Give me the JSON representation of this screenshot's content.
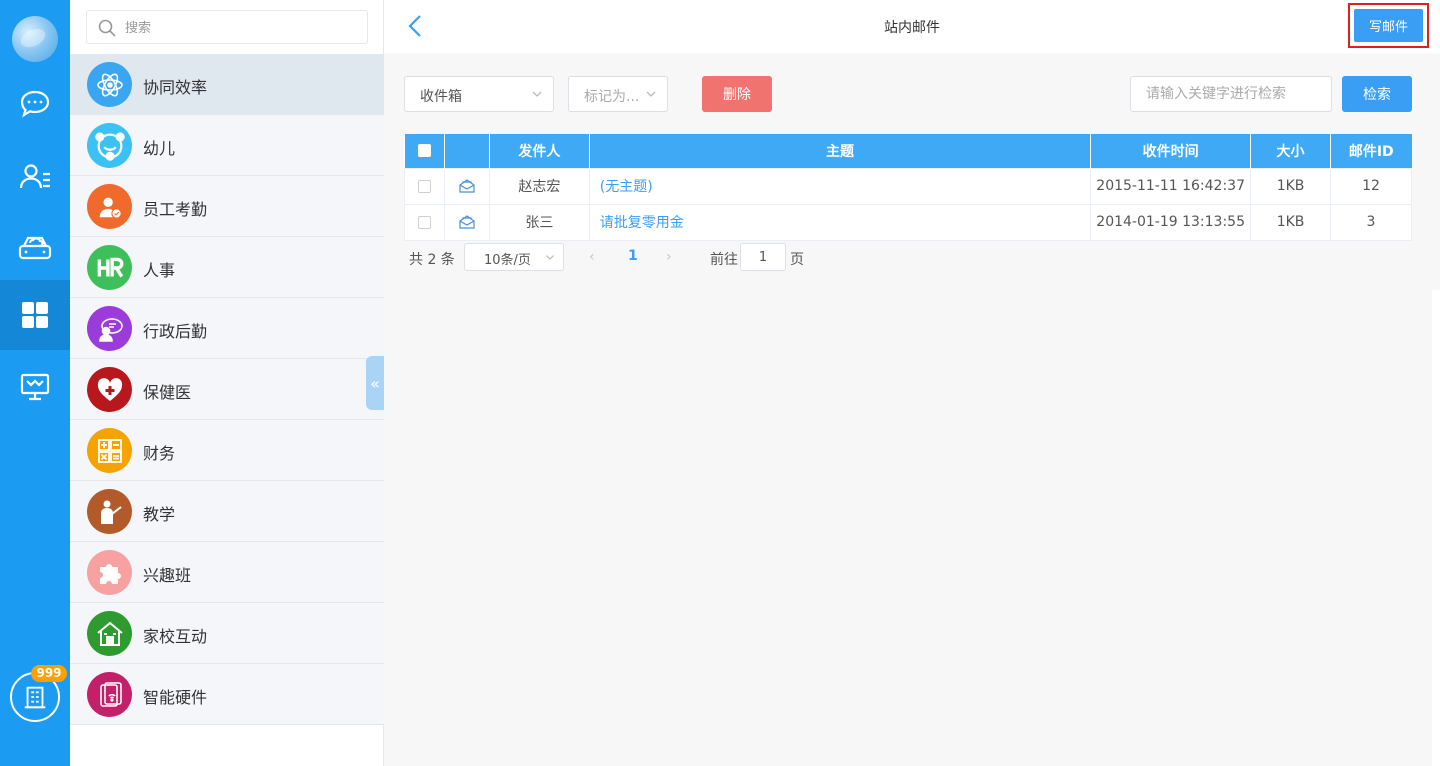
{
  "rail": {
    "items": [
      {
        "icon": "chat-icon"
      },
      {
        "icon": "contacts-icon"
      },
      {
        "icon": "cloud-drive-icon"
      },
      {
        "icon": "apps-grid-icon",
        "active": true
      },
      {
        "icon": "monitor-icon"
      }
    ],
    "badge": "999"
  },
  "sidebar": {
    "search_placeholder": "搜索",
    "categories": [
      {
        "label": "协同效率",
        "color": "#3aa5f0",
        "icon": "atom-icon",
        "active": true
      },
      {
        "label": "幼儿",
        "color": "#3cc1f5",
        "icon": "smiley-icon"
      },
      {
        "label": "员工考勤",
        "color": "#f06a2b",
        "icon": "attendance-icon"
      },
      {
        "label": "人事",
        "color": "#3fbf5a",
        "icon": "hr-icon"
      },
      {
        "label": "行政后勤",
        "color": "#9b3bd9",
        "icon": "admin-icon"
      },
      {
        "label": "保健医",
        "color": "#b8171d",
        "icon": "health-icon"
      },
      {
        "label": "财务",
        "color": "#f5a300",
        "icon": "calculator-icon"
      },
      {
        "label": "教学",
        "color": "#b35a2a",
        "icon": "teacher-icon"
      },
      {
        "label": "兴趣班",
        "color": "#f7a1a1",
        "icon": "puzzle-icon"
      },
      {
        "label": "家校互动",
        "color": "#2f9a2f",
        "icon": "house-icon"
      },
      {
        "label": "智能硬件",
        "color": "#c4206a",
        "icon": "device-icon"
      }
    ]
  },
  "header": {
    "title": "站内邮件",
    "compose_label": "写邮件"
  },
  "toolbar": {
    "folder": "收件箱",
    "mark_as": "标记为...",
    "delete_label": "删除",
    "keyword_placeholder": "请输入关键字进行检索",
    "search_label": "检索"
  },
  "table": {
    "headers": [
      "发件人",
      "主题",
      "收件时间",
      "大小",
      "邮件ID"
    ],
    "rows": [
      {
        "sender": "赵志宏",
        "subject": "(无主题)",
        "time": "2015-11-11 16:42:37",
        "size": "1KB",
        "id": "12"
      },
      {
        "sender": "张三",
        "subject": "请批复零用金",
        "time": "2014-01-19 13:13:55",
        "size": "1KB",
        "id": "3"
      }
    ]
  },
  "pager": {
    "total": "共 2 条",
    "page_size": "10条/页",
    "current": "1",
    "goto_label": "前往",
    "goto_value": "1",
    "page_unit": "页"
  },
  "colors": {
    "primary": "#3a9ef4",
    "rail": "#1b9cf2",
    "danger": "#f0736f",
    "highlight_border": "#e02020"
  }
}
